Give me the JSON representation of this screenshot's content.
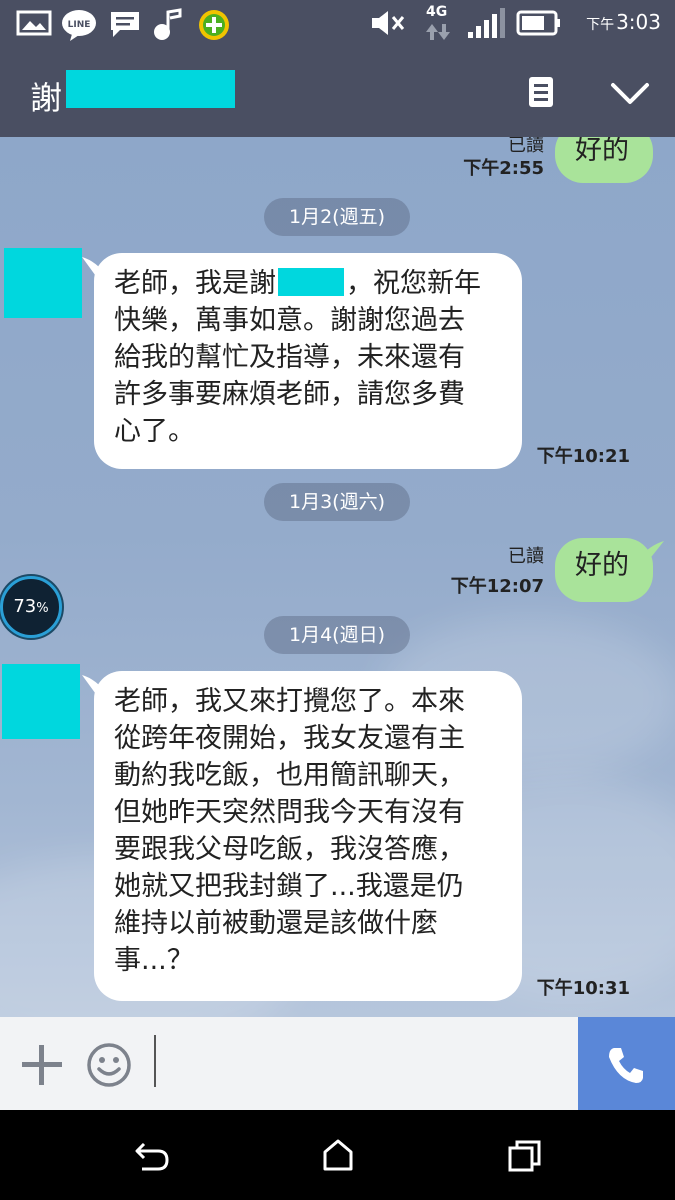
{
  "status_bar": {
    "time_prefix": "下午",
    "time": "3:03",
    "network": "4G",
    "icons": [
      "image-icon",
      "line-icon",
      "message-icon",
      "music-icon",
      "plus-badge-icon",
      "mute-icon",
      "signal-icon",
      "battery-icon"
    ]
  },
  "header": {
    "title_char": "謝"
  },
  "messages": {
    "m0": {
      "read": "已讀",
      "time": "下午2:55",
      "text": "好的"
    },
    "date1": "1月2(週五)",
    "m1": {
      "line1a": "老師，我是謝",
      "line1b": "，祝您新年",
      "line2": "快樂，萬事如意。謝謝您過去",
      "line3": "給我的幫忙及指導，未來還有",
      "line4": "許多事要麻煩老師，請您多費",
      "line5": "心了。",
      "time": "下午10:21"
    },
    "date2": "1月3(週六)",
    "m2": {
      "read": "已讀",
      "time": "下午12:07",
      "text": "好的"
    },
    "date3": "1月4(週日)",
    "m3": {
      "line1": "老師，我又來打攪您了。本來",
      "line2": "從跨年夜開始，我女友還有主",
      "line3": "動約我吃飯，也用簡訊聊天，",
      "line4": "但她昨天突然問我今天有沒有",
      "line5": "要跟我父母吃飯，我沒答應，",
      "line6": "她就又把我封鎖了...我還是仍",
      "line7": "維持以前被動還是該做什麼",
      "line8": "事...？",
      "time": "下午10:31"
    }
  },
  "battery_overlay": {
    "value": "73",
    "unit": "%"
  },
  "colors": {
    "bar": "#4a4f62",
    "incoming": "#ffffff",
    "outgoing": "#a9e39a",
    "call": "#5a87d8",
    "redaction": "#00d7de"
  }
}
